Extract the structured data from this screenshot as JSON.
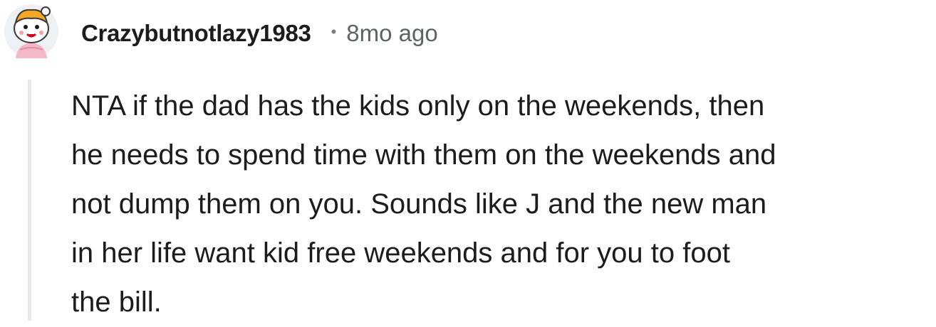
{
  "comment": {
    "author": "Crazybutnotlazy1983",
    "separator": "•",
    "timestamp": "8mo ago",
    "avatar_icon": "snoo-avatar-icon",
    "body_lines": [
      "NTA if the dad has the kids only on the weekends, then",
      "he needs to spend time with them on the weekends and",
      "not dump them on you. Sounds like J and the new man",
      "in her life want kid free weekends and for you to foot",
      "the bill."
    ]
  },
  "colors": {
    "text": "#1c1c1c",
    "meta": "#5f6368",
    "thread_line": "#e7e8e9",
    "background": "#ffffff"
  }
}
